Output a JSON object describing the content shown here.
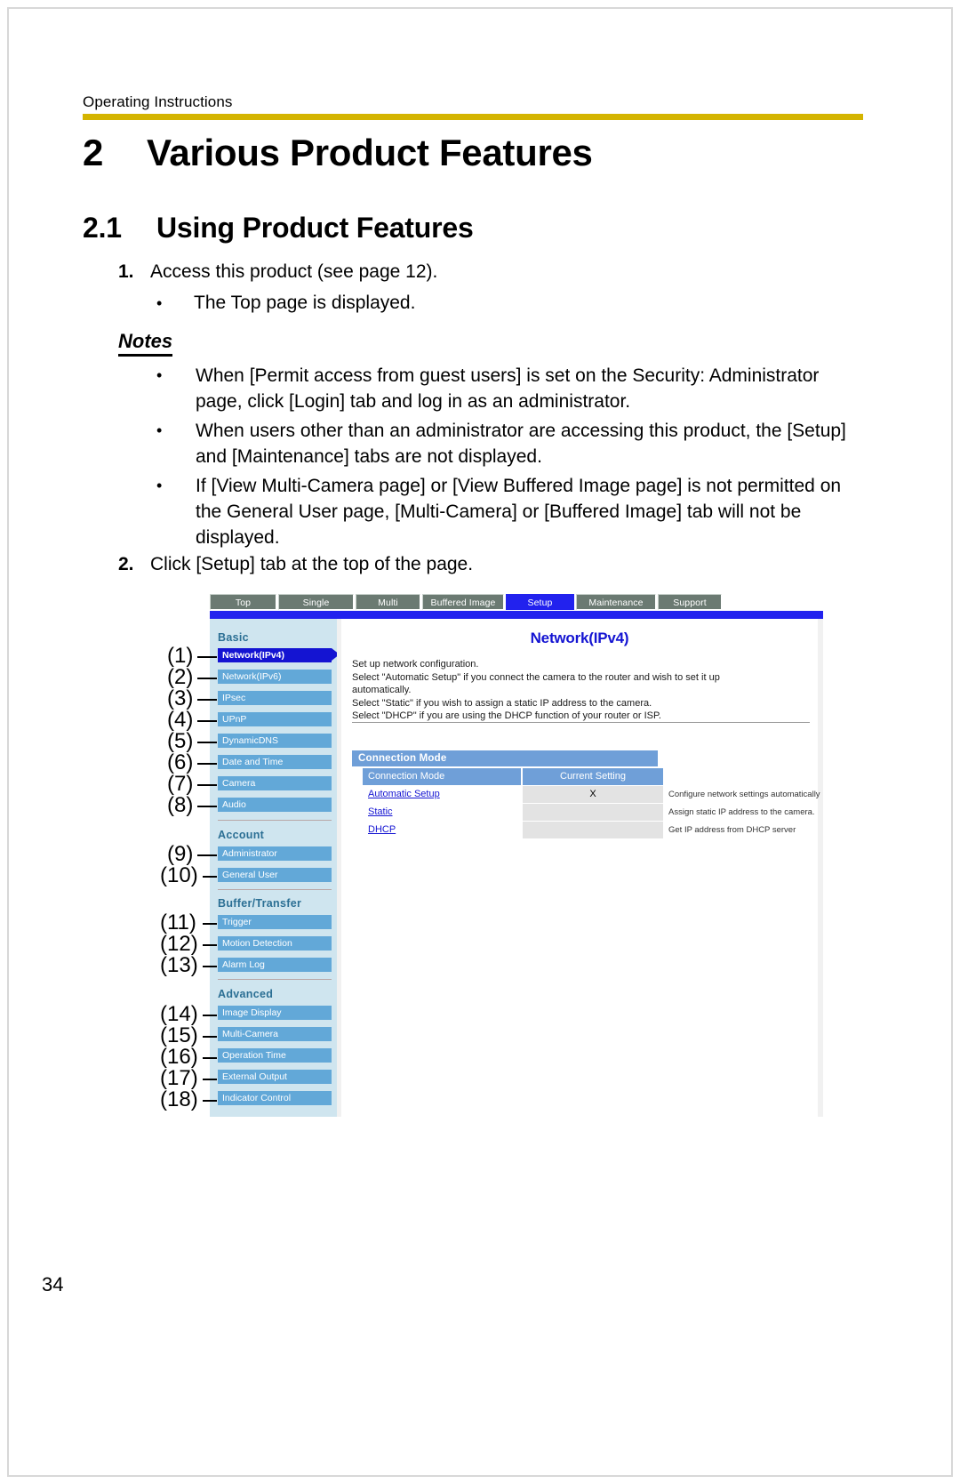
{
  "document": {
    "running_header": "Operating Instructions",
    "page_number": "34",
    "rule_color": "#d4b400"
  },
  "headings": {
    "chapter_number": "2",
    "chapter_title": "Various Product Features",
    "section_number": "2.1",
    "section_title": "Using Product Features"
  },
  "steps": [
    {
      "number": "1.",
      "text": "Access this product (see page 12)."
    },
    {
      "number": "2.",
      "text": "Click [Setup] tab at the top of the page."
    }
  ],
  "sub_bullets": [
    {
      "bullet": "•",
      "text": "The Top page is displayed."
    }
  ],
  "notes": {
    "title": "Notes",
    "bullet": "•",
    "items": [
      "When [Permit access from guest users] is set on the Security: Administrator page, click [Login] tab and log in as an administrator.",
      "When users other than an administrator are accessing this product, the [Setup] and [Maintenance] tabs are not displayed.",
      "If [View Multi-Camera page] or [View Buffered Image page] is not permitted on the General User page, [Multi-Camera] or [Buffered Image] tab will not be displayed."
    ]
  },
  "screenshot": {
    "tabs": [
      {
        "label": "Top",
        "active": false
      },
      {
        "label": "Single",
        "active": false
      },
      {
        "label": "Multi",
        "active": false
      },
      {
        "label": "Buffered Image",
        "active": false
      },
      {
        "label": "Setup",
        "active": true
      },
      {
        "label": "Maintenance",
        "active": false
      },
      {
        "label": "Support",
        "active": false
      }
    ],
    "sidebar": {
      "groups": [
        {
          "title": "Basic",
          "items": [
            {
              "callout": "(1)",
              "label": "Network(IPv4)",
              "selected": true
            },
            {
              "callout": "(2)",
              "label": "Network(IPv6)",
              "selected": false
            },
            {
              "callout": "(3)",
              "label": "IPsec",
              "selected": false
            },
            {
              "callout": "(4)",
              "label": "UPnP",
              "selected": false
            },
            {
              "callout": "(5)",
              "label": "DynamicDNS",
              "selected": false
            },
            {
              "callout": "(6)",
              "label": "Date and Time",
              "selected": false
            },
            {
              "callout": "(7)",
              "label": "Camera",
              "selected": false
            },
            {
              "callout": "(8)",
              "label": "Audio",
              "selected": false
            }
          ]
        },
        {
          "title": "Account",
          "items": [
            {
              "callout": "(9)",
              "label": "Administrator",
              "selected": false
            },
            {
              "callout": "(10)",
              "label": "General User",
              "selected": false
            }
          ]
        },
        {
          "title": "Buffer/Transfer",
          "items": [
            {
              "callout": "(11)",
              "label": "Trigger",
              "selected": false
            },
            {
              "callout": "(12)",
              "label": "Motion Detection",
              "selected": false
            },
            {
              "callout": "(13)",
              "label": "Alarm Log",
              "selected": false
            }
          ]
        },
        {
          "title": "Advanced",
          "items": [
            {
              "callout": "(14)",
              "label": "Image Display",
              "selected": false
            },
            {
              "callout": "(15)",
              "label": "Multi-Camera",
              "selected": false
            },
            {
              "callout": "(16)",
              "label": "Operation Time",
              "selected": false
            },
            {
              "callout": "(17)",
              "label": "External Output",
              "selected": false
            },
            {
              "callout": "(18)",
              "label": "Indicator Control",
              "selected": false
            }
          ]
        }
      ]
    },
    "main": {
      "title": "Network(IPv4)",
      "description_lines": [
        "Set up network configuration.",
        "Select \"Automatic Setup\" if you connect the camera to the router and wish to set it up",
        "automatically.",
        "Select \"Static\" if you wish to assign a static IP address to the camera.",
        "Select \"DHCP\" if you are using the DHCP function of your router or ISP."
      ],
      "connection_mode": {
        "banner": "Connection Mode",
        "headers": [
          "Connection Mode",
          "Current Setting"
        ],
        "rows": [
          {
            "mode": "Automatic Setup",
            "current": "X",
            "note": "Configure network settings automatically"
          },
          {
            "mode": "Static",
            "current": "",
            "note": "Assign static IP address to the camera."
          },
          {
            "mode": "DHCP",
            "current": "",
            "note": "Get IP address from DHCP server"
          }
        ]
      }
    },
    "colors": {
      "tab_inactive": "#6b7a72",
      "tab_active": "#2222ee",
      "sidebar_bg": "#cfe5ef",
      "nav_item": "#62a8d8",
      "nav_selected": "#1414d2",
      "table_header": "#6f9fd8",
      "title_blue": "#1414d2"
    }
  }
}
